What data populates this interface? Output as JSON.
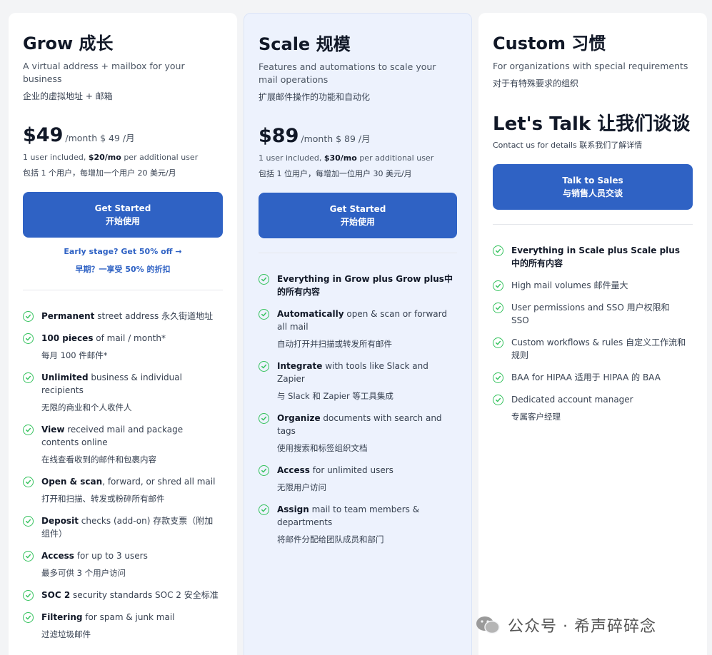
{
  "plans": [
    {
      "title": "Grow 成长",
      "subtitle": "A virtual address + mailbox for your business",
      "subtitle_cn": "企业的虚拟地址 + 邮箱",
      "price": "$49",
      "price_unit": "/month $ 49 /月",
      "fine_before": "1 user included, ",
      "fine_bold": "$20/mo",
      "fine_after": " per additional user",
      "fine_cn": "包括 1 个用户，每增加一个用户 20 美元/月",
      "cta_label": "Get Started",
      "cta_label_cn": "开始使用",
      "promo": "Early stage? Get 50% off →",
      "promo_cn": "早期？一享受 50% 的折扣",
      "features": [
        {
          "bold": "Permanent",
          "rest": " street address 永久街道地址",
          "cn": ""
        },
        {
          "bold": "100 pieces",
          "rest": " of mail / month*",
          "cn": "每月 100 件邮件*"
        },
        {
          "bold": "Unlimited",
          "rest": " business & individual recipients",
          "cn": "无限的商业和个人收件人"
        },
        {
          "bold": "View",
          "rest": " received mail and package contents online",
          "cn": "在线查看收到的邮件和包裹内容"
        },
        {
          "bold": "Open & scan",
          "rest": ", forward, or shred all mail",
          "cn": "打开和扫描、转发或粉碎所有邮件"
        },
        {
          "bold": "Deposit",
          "rest": " checks (add-on) 存款支票（附加组件）",
          "cn": ""
        },
        {
          "bold": "Access",
          "rest": " for up to 3 users",
          "cn": "最多可供 3 个用户访问"
        },
        {
          "bold": "SOC 2",
          "rest": " security standards SOC 2 安全标准",
          "cn": ""
        },
        {
          "bold": "Filtering",
          "rest": " for spam & junk mail",
          "cn": "过滤垃圾邮件"
        }
      ]
    },
    {
      "title": "Scale 规模",
      "subtitle": "Features and automations to scale your mail operations",
      "subtitle_cn": "扩展邮件操作的功能和自动化",
      "price": "$89",
      "price_unit": "/month $ 89 /月",
      "fine_before": "1 user included, ",
      "fine_bold": "$30/mo",
      "fine_after": " per additional user",
      "fine_cn": "包括 1 位用户，每增加一位用户 30 美元/月",
      "cta_label": "Get Started",
      "cta_label_cn": "开始使用",
      "features": [
        {
          "bold": "Everything in Grow plus Grow plus中的所有内容",
          "rest": "",
          "cn": ""
        },
        {
          "bold": "Automatically",
          "rest": " open & scan or forward all mail",
          "cn": "自动打开并扫描或转发所有邮件"
        },
        {
          "bold": "Integrate",
          "rest": " with tools like Slack and Zapier",
          "cn": "与 Slack 和 Zapier 等工具集成"
        },
        {
          "bold": "Organize",
          "rest": " documents with search and tags",
          "cn": "使用搜索和标签组织文档"
        },
        {
          "bold": "Access",
          "rest": " for unlimited users",
          "cn": "无限用户访问"
        },
        {
          "bold": "Assign",
          "rest": " mail to team members & departments",
          "cn": "将邮件分配给团队成员和部门"
        }
      ]
    },
    {
      "title": "Custom 习惯",
      "subtitle": "For organizations with special requirements",
      "subtitle_cn": "对于有特殊要求的组织",
      "talk": "Let's Talk 让我们谈谈",
      "contact": "Contact us for details 联系我们了解详情",
      "cta_label": "Talk to Sales",
      "cta_label_cn": "与销售人员交谈",
      "features": [
        {
          "bold": "Everything in Scale plus Scale plus 中的所有内容",
          "rest": "",
          "cn": ""
        },
        {
          "bold": "",
          "rest": "High mail volumes 邮件量大",
          "cn": ""
        },
        {
          "bold": "",
          "rest": "User permissions and SSO 用户权限和 SSO",
          "cn": ""
        },
        {
          "bold": "",
          "rest": "Custom workflows & rules 自定义工作流和规则",
          "cn": ""
        },
        {
          "bold": "",
          "rest": "BAA for HIPAA 适用于 HIPAA 的 BAA",
          "cn": ""
        },
        {
          "bold": "",
          "rest": "Dedicated account manager",
          "cn": "专属客户经理"
        }
      ]
    }
  ],
  "watermark": "公众号 · 希声碎碎念",
  "colors": {
    "accent": "#2f62c4",
    "check": "#34c25d",
    "featured_bg": "#edf2fd"
  }
}
